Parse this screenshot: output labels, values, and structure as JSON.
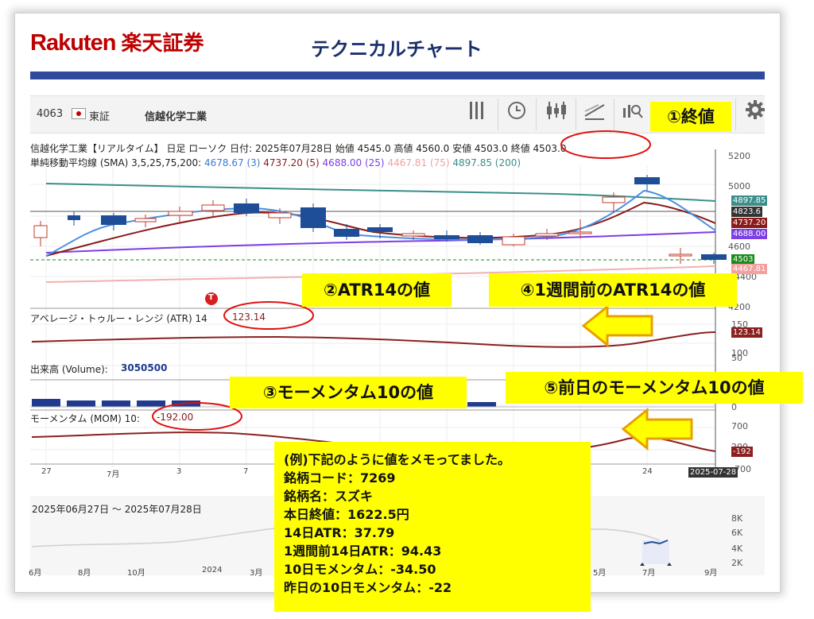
{
  "header": {
    "logo_en": "Rakuten",
    "logo_jp": "楽天証券",
    "title": "テクニカルチャート"
  },
  "toolbar": {
    "code": "4063",
    "exchange": "東証",
    "name": "信越化学工業"
  },
  "info": {
    "line1": "信越化学工業【リアルタイム】 日足 ローソク 日付: 2025年07月28日 始値 4545.0 高値 4560.0 安値 4503.0 終値 4503.0",
    "sma_label": "単純移動平均線 (SMA) 3,5,25,75,200:",
    "sma_values": [
      {
        "text": "4678.67 (3)",
        "color": "#3a7bd5"
      },
      {
        "text": "4737.20 (5)",
        "color": "#8b1a1a"
      },
      {
        "text": "4688.00 (25)",
        "color": "#7b3fe4"
      },
      {
        "text": "4467.81 (75)",
        "color": "#f08080"
      },
      {
        "text": "4897.85 (200)",
        "color": "#3a8f8a"
      }
    ]
  },
  "price_axis": [
    "5200",
    "5000",
    "4800",
    "4600",
    "4400",
    "4200"
  ],
  "price_tags": [
    {
      "text": "4897.85",
      "color": "#3a8f8a"
    },
    {
      "text": "4823.6",
      "color": "#333333"
    },
    {
      "text": "4737.20",
      "color": "#8b1a1a"
    },
    {
      "text": "4688.00",
      "color": "#7b3fe4"
    },
    {
      "text": "4503",
      "color": "#1a8a1a"
    },
    {
      "text": "4467.81",
      "color": "#f4a0a0"
    }
  ],
  "atr": {
    "label": "アベレージ・トゥルー・レンジ (ATR) 14",
    "value": "123.14",
    "axis": [
      "150",
      "100",
      "50"
    ],
    "tag": "123.14"
  },
  "volume": {
    "label": "出来高 (Volume):",
    "value": "3050500",
    "axis": [
      "0"
    ]
  },
  "mom": {
    "label": "モーメンタム (MOM) 10:",
    "value": "-192.00",
    "axis": [
      "700",
      "200",
      "700"
    ],
    "tag": "-192"
  },
  "x_axis": [
    "27",
    "7月",
    "3",
    "7",
    "24"
  ],
  "date_tag": "2025-07-28",
  "overview": {
    "range": "2025年06月27日 ～ 2025年07月28日",
    "axis": [
      "8K",
      "6K",
      "4K",
      "2K"
    ],
    "x": [
      "6月",
      "8月",
      "10月",
      "2024",
      "3月",
      "5月",
      "7月",
      "9月"
    ]
  },
  "callouts": {
    "c1": "①終値",
    "c2": "②ATR14の値",
    "c3": "③モーメンタム10の値",
    "c4": "④1週間前のATR14の値",
    "c5": "⑤前日のモーメンタム10の値"
  },
  "memo": [
    "(例)下記のように値をメモってました。",
    "銘柄コード：7269",
    "銘柄名：スズキ",
    "本日終値：1622.5円",
    "14日ATR：37.79",
    "1週間前14日ATR：94.43",
    "10日モメンタム：-34.50",
    "昨日の10日モメンタム：-22"
  ],
  "icons": [
    "bars-icon",
    "clock-icon",
    "candlestick-icon",
    "drawing-icon",
    "search-chart-icon",
    "gear-icon"
  ],
  "t_marker": "T",
  "colors": {
    "accent_red": "#bf0000",
    "navy": "#1a2f6b",
    "highlight": "#ffff00",
    "ellipse": "#e01010"
  }
}
